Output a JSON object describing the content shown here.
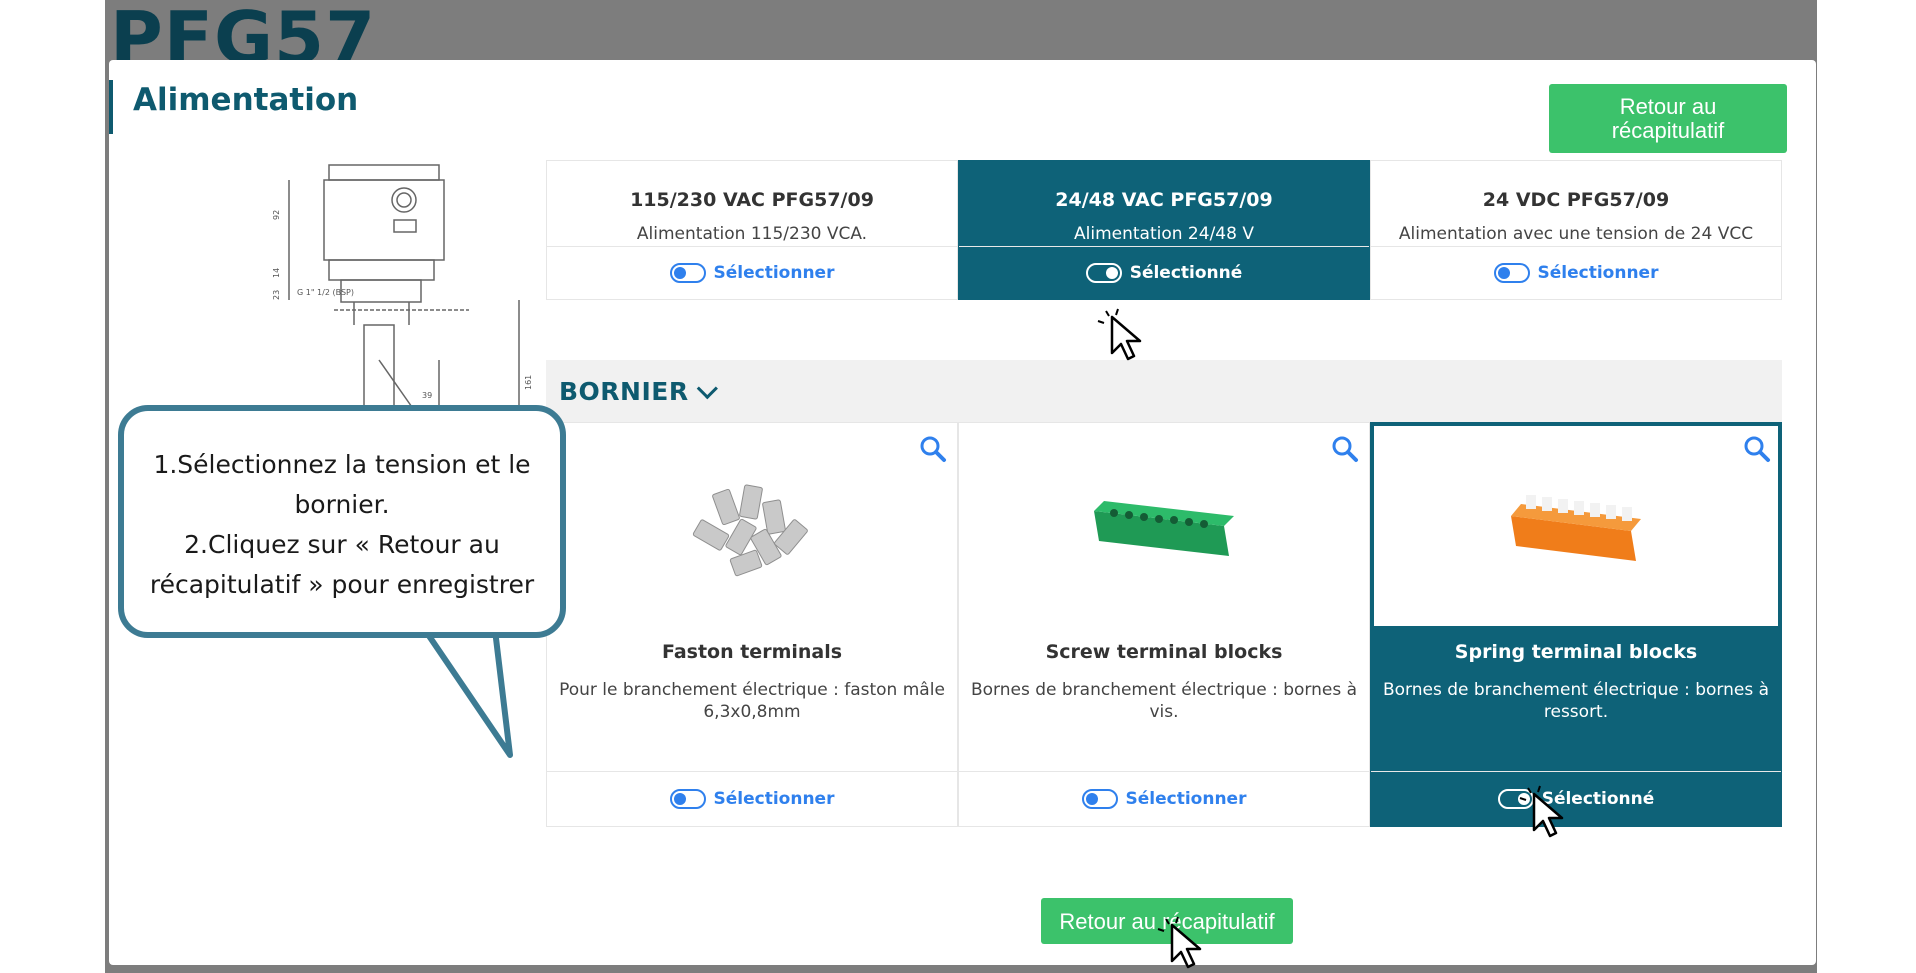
{
  "background": {
    "title": "PFG57"
  },
  "modal": {
    "title": "Alimentation",
    "top_button": "Retour au récapitulatif",
    "bottom_button": "Retour au récapitulatif"
  },
  "alimentation_cards": [
    {
      "name": "115/230 VAC PFG57/09",
      "desc": "Alimentation 115/230 VCA.",
      "action": "Sélectionner",
      "selected": false
    },
    {
      "name": "24/48 VAC PFG57/09",
      "desc": "Alimentation 24/48 V",
      "action": "Sélectionné",
      "selected": true
    },
    {
      "name": "24 VDC PFG57/09",
      "desc": "Alimentation avec une tension de 24 VCC",
      "action": "Sélectionner",
      "selected": false
    }
  ],
  "bornier": {
    "title": "BORNIER",
    "cards": [
      {
        "name": "Faston terminals",
        "desc": "Pour le branchement électrique : faston mâle 6,3x0,8mm",
        "action": "Sélectionner",
        "selected": false,
        "image": "faston-terminals-image"
      },
      {
        "name": "Screw terminal blocks",
        "desc": "Bornes de branchement électrique : bornes à vis.",
        "action": "Sélectionner",
        "selected": false,
        "image": "screw-terminal-image"
      },
      {
        "name": "Spring terminal blocks",
        "desc": "Bornes de branchement électrique : bornes à ressort.",
        "action": "Sélectionné",
        "selected": true,
        "image": "spring-terminal-image"
      }
    ]
  },
  "callout": {
    "line1": "1.Sélectionnez la tension et le bornier.",
    "line2": "2.Cliquez sur « Retour au récapitulatif » pour enregistrer"
  },
  "colors": {
    "accent": "#0e6278",
    "green": "#3cc26b",
    "toggle": "#2f80ed",
    "bubble_border": "#3d7b93"
  }
}
